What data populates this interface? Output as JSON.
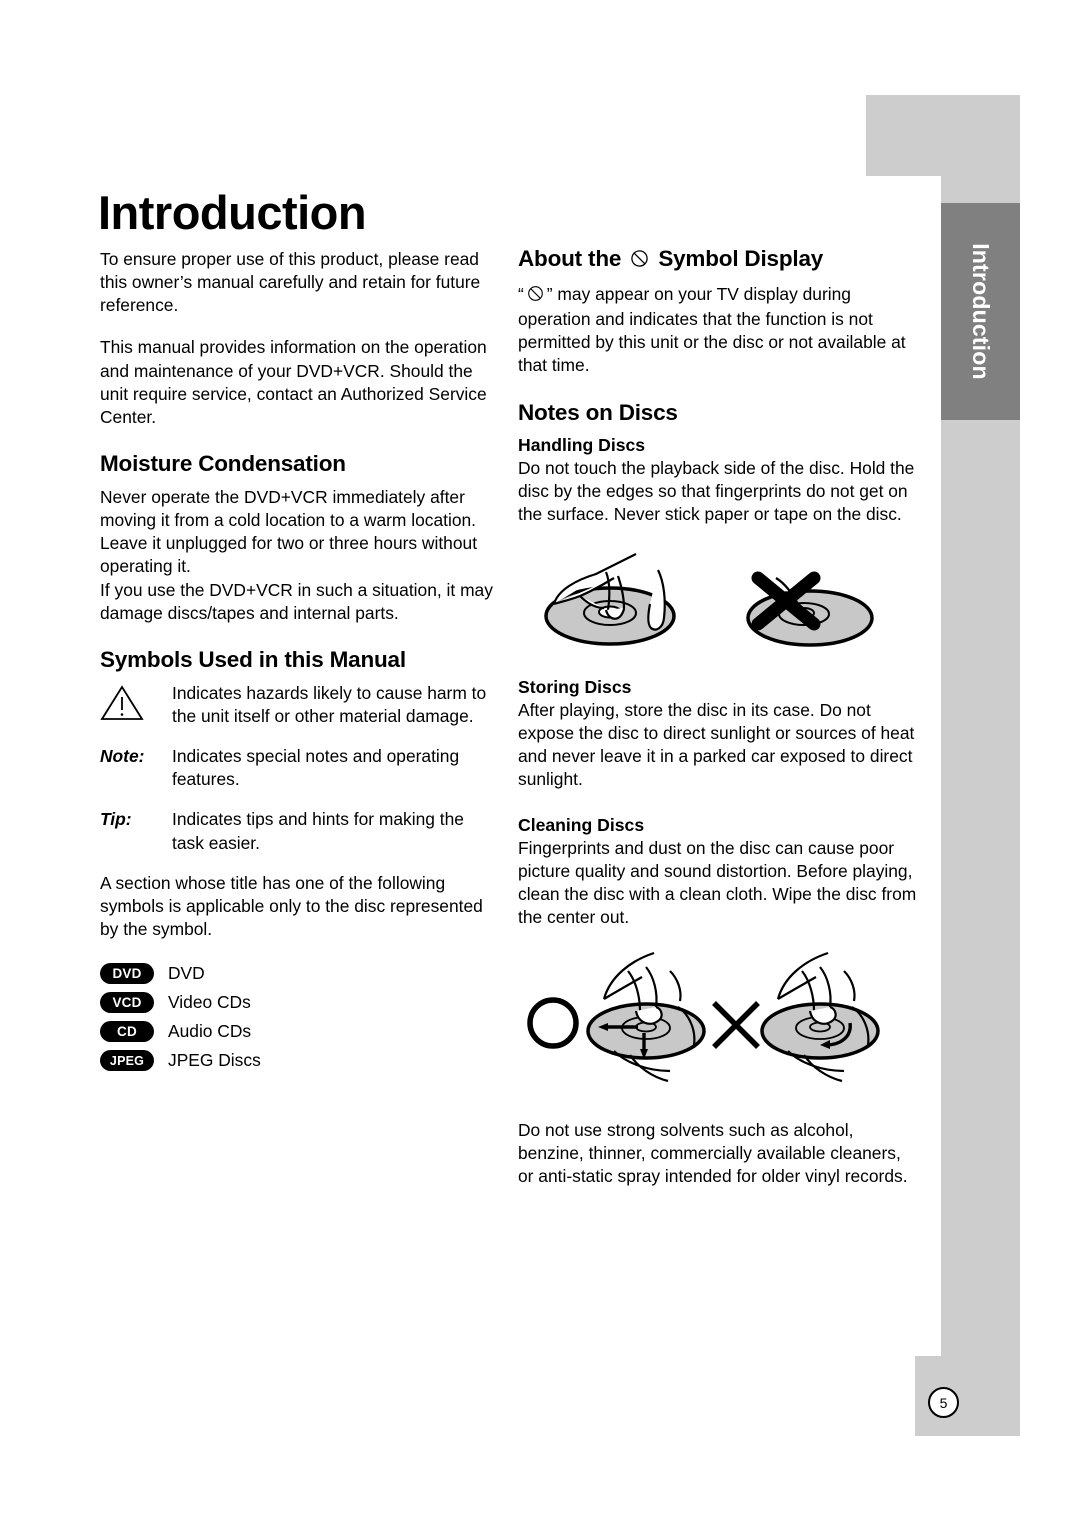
{
  "page": {
    "title": "Introduction",
    "number": "5",
    "side_tab_label": "Introduction"
  },
  "left_column": {
    "intro_paragraphs": [
      "To ensure proper use of this product, please read this owner’s manual carefully and retain for future reference.",
      "This manual provides information on the operation and maintenance of your DVD+VCR. Should the unit require service, contact an Authorized Service Center."
    ],
    "moisture": {
      "heading": "Moisture Condensation",
      "paragraphs": [
        "Never operate the DVD+VCR immediately after moving it from a cold location to a warm location. Leave it unplugged for two or three hours without operating it.",
        "If you use the DVD+VCR in such a situation, it may damage discs/tapes and internal parts."
      ]
    },
    "symbols": {
      "heading": "Symbols Used in this Manual",
      "rows": [
        {
          "key": "",
          "icon": "warning-triangle-icon",
          "desc": "Indicates hazards likely to cause harm to the unit itself or other material damage."
        },
        {
          "key": "Note:",
          "icon": "",
          "desc": "Indicates special notes and operating features."
        },
        {
          "key": "Tip:",
          "icon": "",
          "desc": "Indicates tips and hints for making the task easier."
        }
      ],
      "closing_paragraph": "A section whose title has one of the following symbols is applicable only to the disc represented by the symbol.",
      "disc_badges": [
        {
          "badge": "DVD",
          "label": "DVD"
        },
        {
          "badge": "VCD",
          "label": "Video CDs"
        },
        {
          "badge": "CD",
          "label": "Audio CDs"
        },
        {
          "badge": "JPEG",
          "label": "JPEG Discs"
        }
      ]
    }
  },
  "right_column": {
    "about_symbol": {
      "heading_before": "About the",
      "heading_symbol": "prohibition-symbol-icon",
      "heading_after": "Symbol Display",
      "paragraph_before_symbol": "“",
      "paragraph_after_symbol": "” may appear on your TV display during operation and indicates that the function is not permitted by this unit or the disc or not available at that time."
    },
    "notes_on_discs": {
      "heading": "Notes on Discs",
      "handling": {
        "subheading": "Handling Discs",
        "text": "Do not touch the playback side of the disc. Hold the disc by the edges so that fingerprints do not get on the surface. Never stick paper or tape on the disc."
      },
      "storing": {
        "subheading": "Storing Discs",
        "text": "After playing, store the disc in its case. Do not expose the disc to direct sunlight or sources of heat and never leave it in a parked car exposed to direct sunlight."
      },
      "cleaning": {
        "subheading": "Cleaning Discs",
        "text": "Fingerprints and dust on the disc can cause poor picture quality and sound distortion. Before playing, clean the disc with a clean cloth. Wipe the disc from the center out."
      },
      "solvents_warning": "Do not use strong solvents such as alcohol, benzine, thinner, commercially available cleaners, or anti-static spray intended for older vinyl records."
    }
  },
  "colors": {
    "tab_light": "#cdcdcd",
    "tab_dark": "#808080",
    "text": "#000000",
    "disc_fill": "#c8c8c8",
    "page_background": "#ffffff"
  }
}
